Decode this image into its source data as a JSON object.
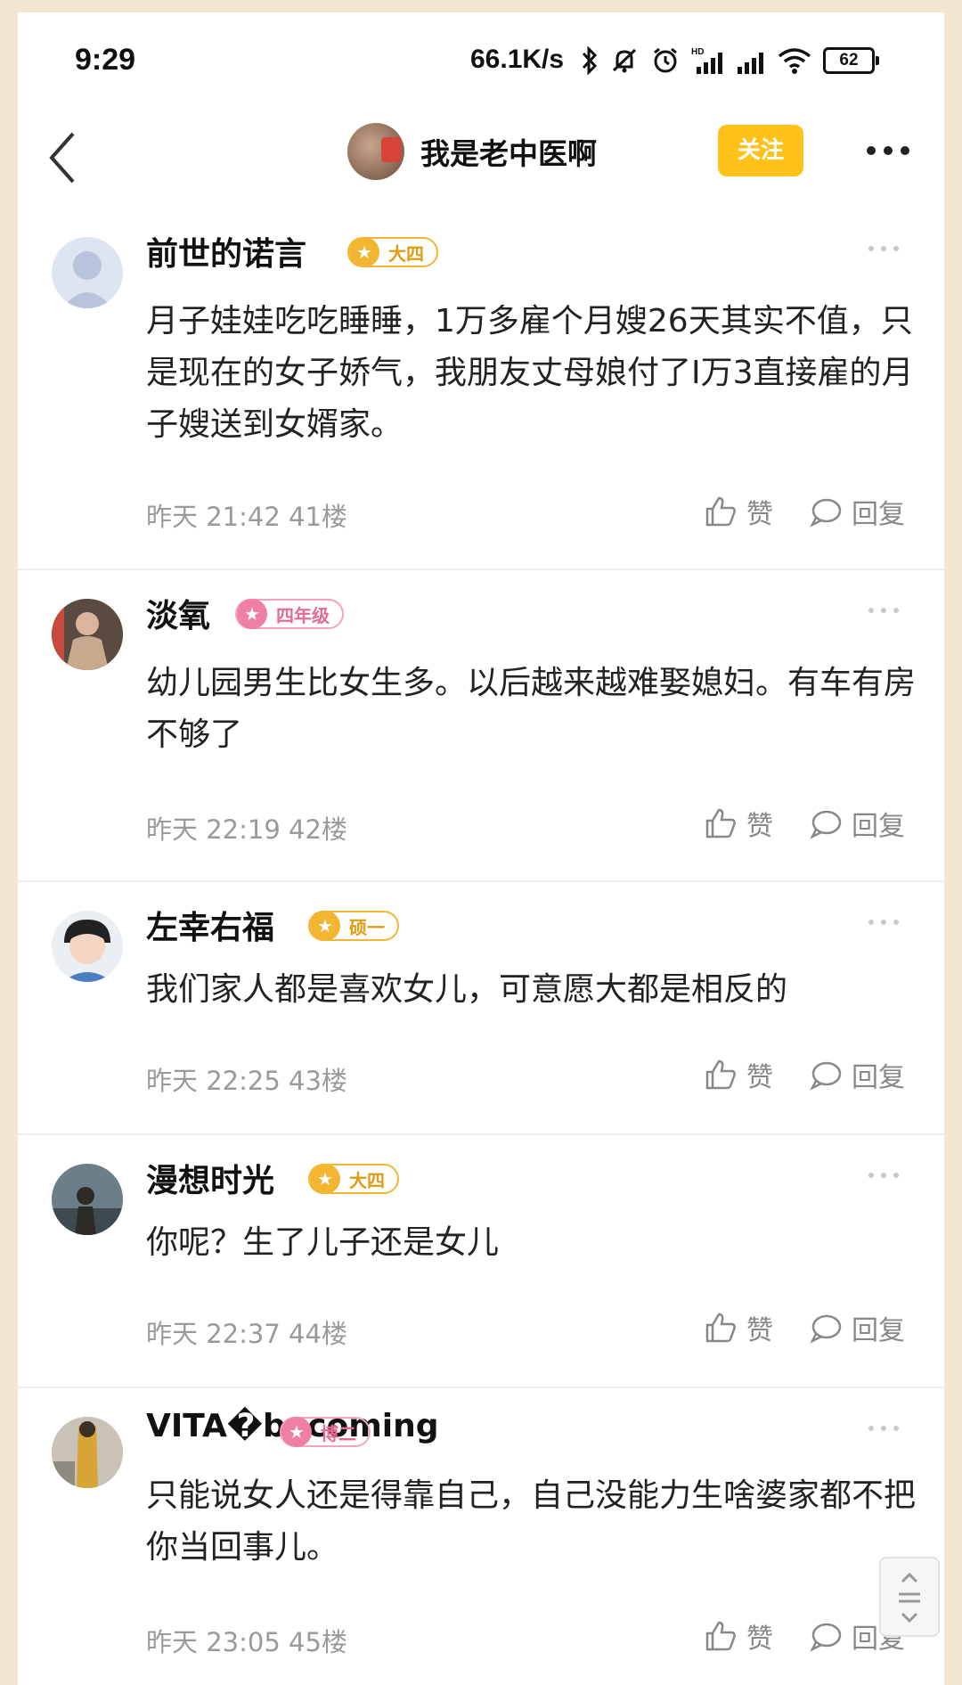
{
  "status_bar": {
    "time": "9:29",
    "net_speed": "66.1K/s",
    "battery": "62",
    "icons": [
      "bluetooth-icon",
      "mute-icon",
      "alarm-icon",
      "hd-signal-icon",
      "signal-icon",
      "wifi-icon",
      "battery-icon"
    ]
  },
  "header": {
    "title": "我是老中医啊",
    "follow_label": "关注",
    "accent": "#ffc21a"
  },
  "comments": [
    {
      "username": "前世的诺言",
      "badge": "大四",
      "badge_color": "gold",
      "text": "月子娃娃吃吃睡睡，1万多雇个月嫂26天其实不值，只是现在的女子娇气，我朋友丈母娘付了I万3直接雇的月子嫂送到女婿家。",
      "meta": "昨天 21:42  41楼",
      "like_label": "赞",
      "reply_label": "回复"
    },
    {
      "username": "淡氧",
      "badge": "四年级",
      "badge_color": "pink",
      "text": "幼儿园男生比女生多。以后越来越难娶媳妇。有车有房不够了",
      "meta": "昨天 22:19  42楼",
      "like_label": "赞",
      "reply_label": "回复"
    },
    {
      "username": "左幸右福",
      "badge": "硕一",
      "badge_color": "gold",
      "text": "我们家人都是喜欢女儿，可意愿大都是相反的",
      "meta": "昨天 22:25  43楼",
      "like_label": "赞",
      "reply_label": "回复"
    },
    {
      "username": "漫想时光",
      "badge": "大四",
      "badge_color": "gold",
      "text": "你呢？生了儿子还是女儿",
      "meta": "昨天 22:37  44楼",
      "like_label": "赞",
      "reply_label": "回复"
    },
    {
      "username": "VITA�becoming",
      "badge": "博二",
      "badge_color": "pink",
      "text": "只能说女人还是得靠自己，自己没能力生啥婆家都不把你当回事儿。",
      "meta": "昨天 23:05  45楼",
      "like_label": "赞",
      "reply_label": "回复"
    }
  ]
}
